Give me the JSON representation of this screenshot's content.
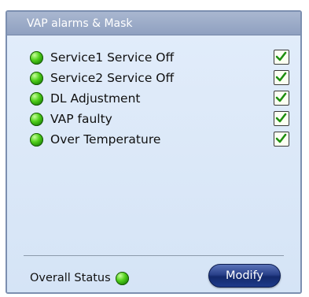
{
  "panel": {
    "title": "VAP alarms & Mask"
  },
  "alarms": [
    {
      "label": "Service1 Service Off",
      "status": "green",
      "masked": true
    },
    {
      "label": "Service2 Service Off",
      "status": "green",
      "masked": true
    },
    {
      "label": "DL Adjustment",
      "status": "green",
      "masked": true
    },
    {
      "label": "VAP faulty",
      "status": "green",
      "masked": true
    },
    {
      "label": "Over Temperature",
      "status": "green",
      "masked": true
    }
  ],
  "footer": {
    "overall_label": "Overall Status",
    "overall_status": "green",
    "modify_label": "Modify"
  },
  "colors": {
    "status_ok": "#3fbf12",
    "panel_header": "#97a8c6",
    "panel_bg": "#dbe8f8",
    "button": "#1e3a8a"
  },
  "icons": {
    "status": "green-led-icon",
    "mask": "checkmark-icon"
  }
}
